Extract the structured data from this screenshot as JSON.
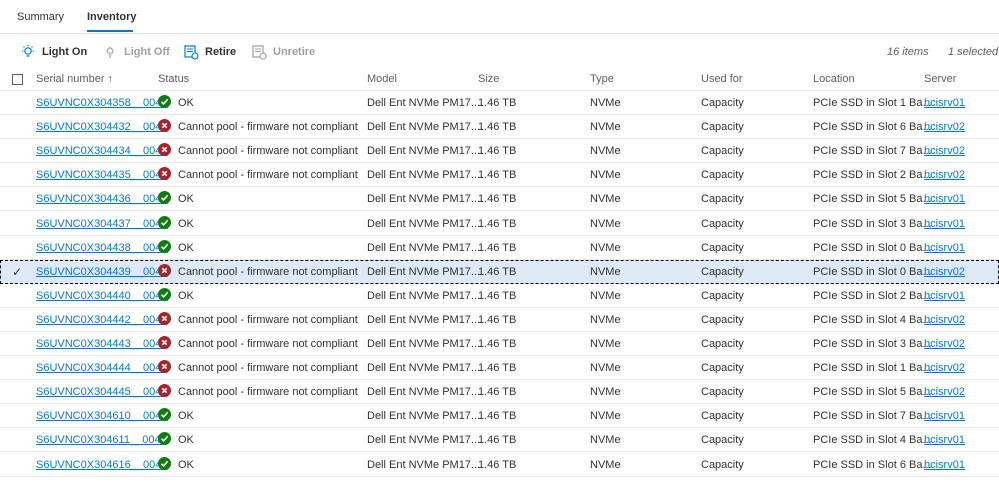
{
  "tabs": [
    {
      "label": "Summary",
      "active": false
    },
    {
      "label": "Inventory",
      "active": true
    }
  ],
  "toolbar": {
    "buttons": [
      {
        "label": "Light On",
        "icon": "lightbulb-on-icon",
        "enabled": true
      },
      {
        "label": "Light Off",
        "icon": "lightbulb-off-icon",
        "enabled": false
      },
      {
        "label": "Retire",
        "icon": "retire-icon",
        "enabled": true
      },
      {
        "label": "Unretire",
        "icon": "unretire-icon",
        "enabled": false
      }
    ],
    "item_count": "16 items",
    "selected_count": "1 selected"
  },
  "columns": [
    "Serial number",
    "Status",
    "Model",
    "Size",
    "Type",
    "Used for",
    "Location",
    "Server"
  ],
  "sort_indicator": "↑",
  "colors": {
    "accent": "#0078d4",
    "ok": "#107c10",
    "error": "#a4262c",
    "selected_row": "#dde9f6"
  },
  "rows": [
    {
      "serial": "S6UVNC0X304358__0041",
      "status": "OK",
      "status_type": "ok",
      "model": "Dell Ent NVMe PM17...",
      "size": "1.46 TB",
      "type": "NVMe",
      "used_for": "Capacity",
      "location": "PCIe SSD in Slot 1 Ba...",
      "server": "hcisrv01",
      "selected": false
    },
    {
      "serial": "S6UVNC0X304432__0041",
      "status": "Cannot pool - firmware not compliant",
      "status_type": "error",
      "model": "Dell Ent NVMe PM17...",
      "size": "1.46 TB",
      "type": "NVMe",
      "used_for": "Capacity",
      "location": "PCIe SSD in Slot 6 Ba...",
      "server": "hcisrv02",
      "selected": false
    },
    {
      "serial": "S6UVNC0X304434__0041",
      "status": "Cannot pool - firmware not compliant",
      "status_type": "error",
      "model": "Dell Ent NVMe PM17...",
      "size": "1.46 TB",
      "type": "NVMe",
      "used_for": "Capacity",
      "location": "PCIe SSD in Slot 7 Ba...",
      "server": "hcisrv02",
      "selected": false
    },
    {
      "serial": "S6UVNC0X304435__0041",
      "status": "Cannot pool - firmware not compliant",
      "status_type": "error",
      "model": "Dell Ent NVMe PM17...",
      "size": "1.46 TB",
      "type": "NVMe",
      "used_for": "Capacity",
      "location": "PCIe SSD in Slot 2 Ba...",
      "server": "hcisrv02",
      "selected": false
    },
    {
      "serial": "S6UVNC0X304436__0041",
      "status": "OK",
      "status_type": "ok",
      "model": "Dell Ent NVMe PM17...",
      "size": "1.46 TB",
      "type": "NVMe",
      "used_for": "Capacity",
      "location": "PCIe SSD in Slot 5 Ba...",
      "server": "hcisrv01",
      "selected": false
    },
    {
      "serial": "S6UVNC0X304437__0041",
      "status": "OK",
      "status_type": "ok",
      "model": "Dell Ent NVMe PM17...",
      "size": "1.46 TB",
      "type": "NVMe",
      "used_for": "Capacity",
      "location": "PCIe SSD in Slot 3 Ba...",
      "server": "hcisrv01",
      "selected": false
    },
    {
      "serial": "S6UVNC0X304438__0041",
      "status": "OK",
      "status_type": "ok",
      "model": "Dell Ent NVMe PM17...",
      "size": "1.46 TB",
      "type": "NVMe",
      "used_for": "Capacity",
      "location": "PCIe SSD in Slot 0 Ba...",
      "server": "hcisrv01",
      "selected": false
    },
    {
      "serial": "S6UVNC0X304439__0041",
      "status": "Cannot pool - firmware not compliant",
      "status_type": "error",
      "model": "Dell Ent NVMe PM17...",
      "size": "1.46 TB",
      "type": "NVMe",
      "used_for": "Capacity",
      "location": "PCIe SSD in Slot 0 Ba...",
      "server": "hcisrv02",
      "selected": true
    },
    {
      "serial": "S6UVNC0X304440__0041",
      "status": "OK",
      "status_type": "ok",
      "model": "Dell Ent NVMe PM17...",
      "size": "1.46 TB",
      "type": "NVMe",
      "used_for": "Capacity",
      "location": "PCIe SSD in Slot 2 Ba...",
      "server": "hcisrv01",
      "selected": false
    },
    {
      "serial": "S6UVNC0X304442__0041",
      "status": "Cannot pool - firmware not compliant",
      "status_type": "error",
      "model": "Dell Ent NVMe PM17...",
      "size": "1.46 TB",
      "type": "NVMe",
      "used_for": "Capacity",
      "location": "PCIe SSD in Slot 4 Ba...",
      "server": "hcisrv02",
      "selected": false
    },
    {
      "serial": "S6UVNC0X304443__0041",
      "status": "Cannot pool - firmware not compliant",
      "status_type": "error",
      "model": "Dell Ent NVMe PM17...",
      "size": "1.46 TB",
      "type": "NVMe",
      "used_for": "Capacity",
      "location": "PCIe SSD in Slot 3 Ba...",
      "server": "hcisrv02",
      "selected": false
    },
    {
      "serial": "S6UVNC0X304444__0041",
      "status": "Cannot pool - firmware not compliant",
      "status_type": "error",
      "model": "Dell Ent NVMe PM17...",
      "size": "1.46 TB",
      "type": "NVMe",
      "used_for": "Capacity",
      "location": "PCIe SSD in Slot 1 Ba...",
      "server": "hcisrv02",
      "selected": false
    },
    {
      "serial": "S6UVNC0X304445__0041",
      "status": "Cannot pool - firmware not compliant",
      "status_type": "error",
      "model": "Dell Ent NVMe PM17...",
      "size": "1.46 TB",
      "type": "NVMe",
      "used_for": "Capacity",
      "location": "PCIe SSD in Slot 5 Ba...",
      "server": "hcisrv02",
      "selected": false
    },
    {
      "serial": "S6UVNC0X304610__0041",
      "status": "OK",
      "status_type": "ok",
      "model": "Dell Ent NVMe PM17...",
      "size": "1.46 TB",
      "type": "NVMe",
      "used_for": "Capacity",
      "location": "PCIe SSD in Slot 7 Ba...",
      "server": "hcisrv01",
      "selected": false
    },
    {
      "serial": "S6UVNC0X304611__0041",
      "status": "OK",
      "status_type": "ok",
      "model": "Dell Ent NVMe PM17...",
      "size": "1.46 TB",
      "type": "NVMe",
      "used_for": "Capacity",
      "location": "PCIe SSD in Slot 4 Ba...",
      "server": "hcisrv01",
      "selected": false
    },
    {
      "serial": "S6UVNC0X304616__0041",
      "status": "OK",
      "status_type": "ok",
      "model": "Dell Ent NVMe PM17...",
      "size": "1.46 TB",
      "type": "NVMe",
      "used_for": "Capacity",
      "location": "PCIe SSD in Slot 6 Ba...",
      "server": "hcisrv01",
      "selected": false
    }
  ]
}
